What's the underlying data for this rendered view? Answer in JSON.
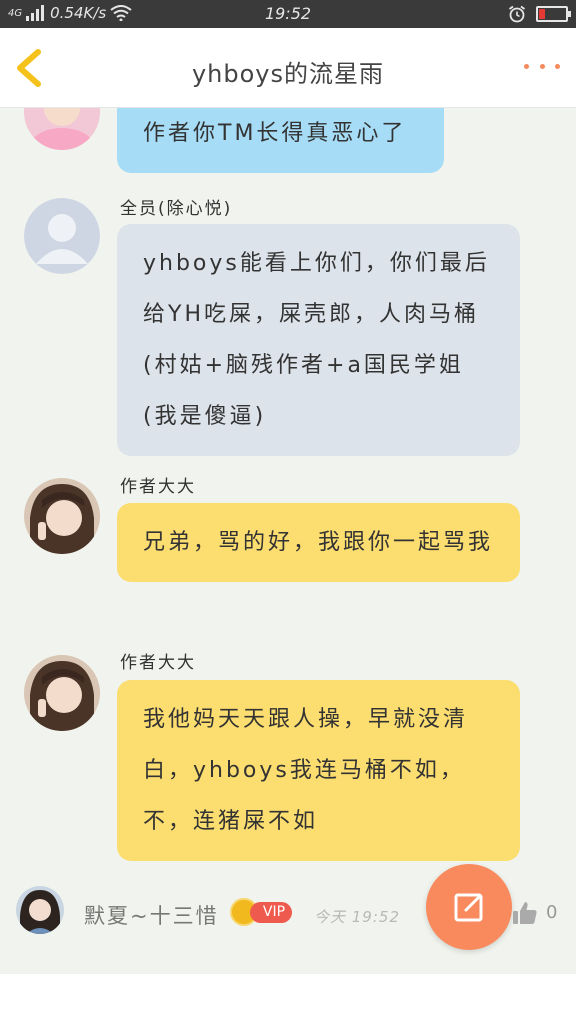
{
  "status_bar": {
    "network": "4G",
    "speed": "0.54K/s",
    "time": "19:52",
    "battery_level": 0.2
  },
  "header": {
    "title": "yhboys的流星雨",
    "back_icon": "chevron-left-icon",
    "more_icon": "more-dots-icon",
    "accent_color": "#f58a5c"
  },
  "messages": [
    {
      "sender": "",
      "text": "作者你TM长得真恶心了",
      "color": "#a6dcf6"
    },
    {
      "sender": "全员(除心悦)",
      "text": "yhboys能看上你们，你们最后给YH吃屎，屎壳郎，人肉马桶(村姑+脑残作者+a国民学姐(我是傻逼)",
      "color": "#dde3ea"
    },
    {
      "sender": "作者大大",
      "text": "兄弟，骂的好，我跟你一起骂我",
      "color": "#fcdd6f"
    },
    {
      "sender": "作者大大",
      "text": "我他妈天天跟人操，早就没清白，yhboys我连马桶不如，不，连猪屎不如",
      "color": "#fcdd6f"
    }
  ],
  "footer": {
    "username": "默夏~十三惜",
    "vip_label": "VIP",
    "time": "今天 19:52",
    "likes": "0",
    "compose_icon": "edit-icon",
    "like_icon": "thumbs-up-icon"
  }
}
